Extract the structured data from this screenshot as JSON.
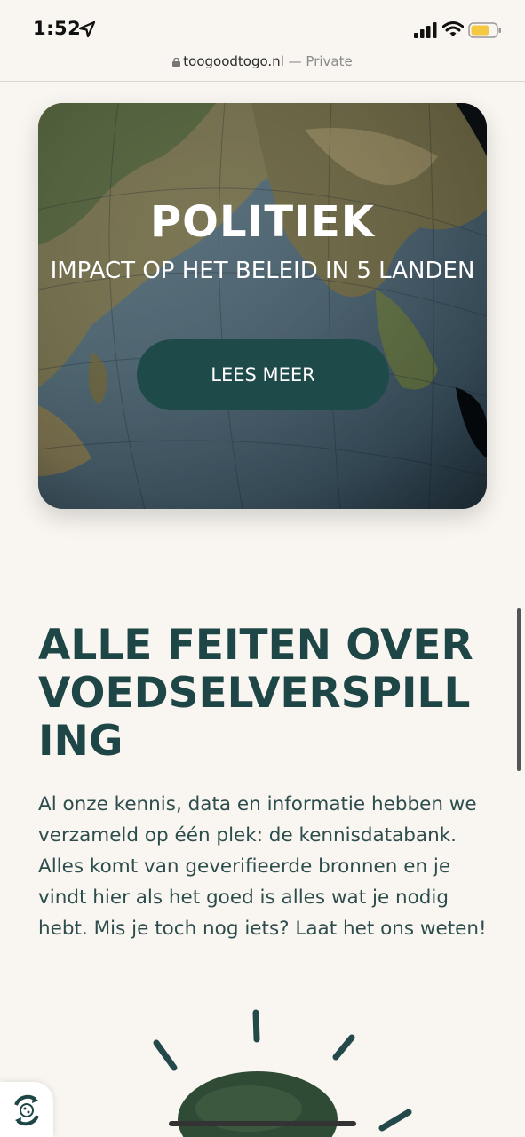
{
  "status_bar": {
    "time": "1:52",
    "icons": [
      "location-arrow-icon",
      "cellular-signal-icon",
      "wifi-icon",
      "battery-icon"
    ],
    "battery_color": "#f5c842"
  },
  "url_bar": {
    "domain": "toogoodtogo.nl",
    "separator": "—",
    "mode": "Private"
  },
  "hero_card": {
    "title": "POLITIEK",
    "subtitle": "IMPACT OP HET BELEID IN 5 LANDEN",
    "button_label": "LEES MEER",
    "button_color": "#1f4a4a"
  },
  "section": {
    "headline": "ALLE FEITEN OVER VOEDSELVERSPILLING",
    "body": "Al onze kennis, data en informatie hebben we verzameld op één plek: de kennisdatabank. Alles komt van geverifieerde bronnen en je vindt hier als het goed is alles wat je nodig hebt. Mis je toch nog iets? Laat het ons weten!",
    "text_color": "#1f4646"
  },
  "floating_widget": {
    "icon": "recycle-cookie-icon"
  },
  "colors": {
    "background": "#f9f6f1",
    "accent": "#1f4646"
  }
}
